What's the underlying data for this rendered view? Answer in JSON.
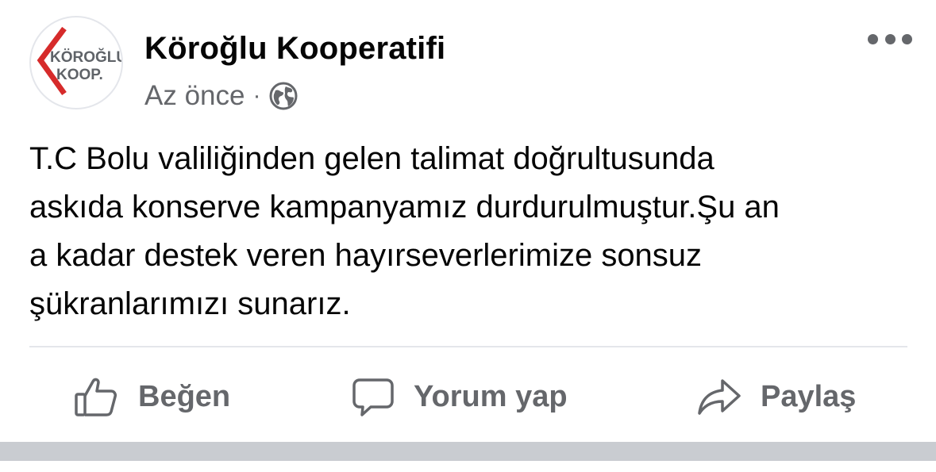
{
  "post": {
    "author": "Köroğlu Kooperatifi",
    "logo": {
      "line1": "KÖROĞLU",
      "line2": "KOOP."
    },
    "timestamp": "Az önce",
    "separator": "·",
    "audience_icon": "globe-icon",
    "more_icon": "more-options-icon",
    "message_lines": [
      "T.C Bolu valiliğinden gelen talimat doğrultusunda",
      "askıda konserve kampanyamız durdurulmuştur.Şu an",
      "a kadar destek veren hayırseverlerimize sonsuz",
      "şükranlarımızı sunarız."
    ]
  },
  "actions": {
    "like": {
      "label": "Beğen",
      "icon": "thumbs-up-icon"
    },
    "comment": {
      "label": "Yorum yap",
      "icon": "comment-icon"
    },
    "share": {
      "label": "Paylaş",
      "icon": "share-arrow-icon"
    }
  },
  "colors": {
    "primary_text": "#050505",
    "secondary_text": "#65676b",
    "divider": "#e4e6eb",
    "logo_red": "#d62b2b",
    "logo_gray": "#5f6368"
  }
}
